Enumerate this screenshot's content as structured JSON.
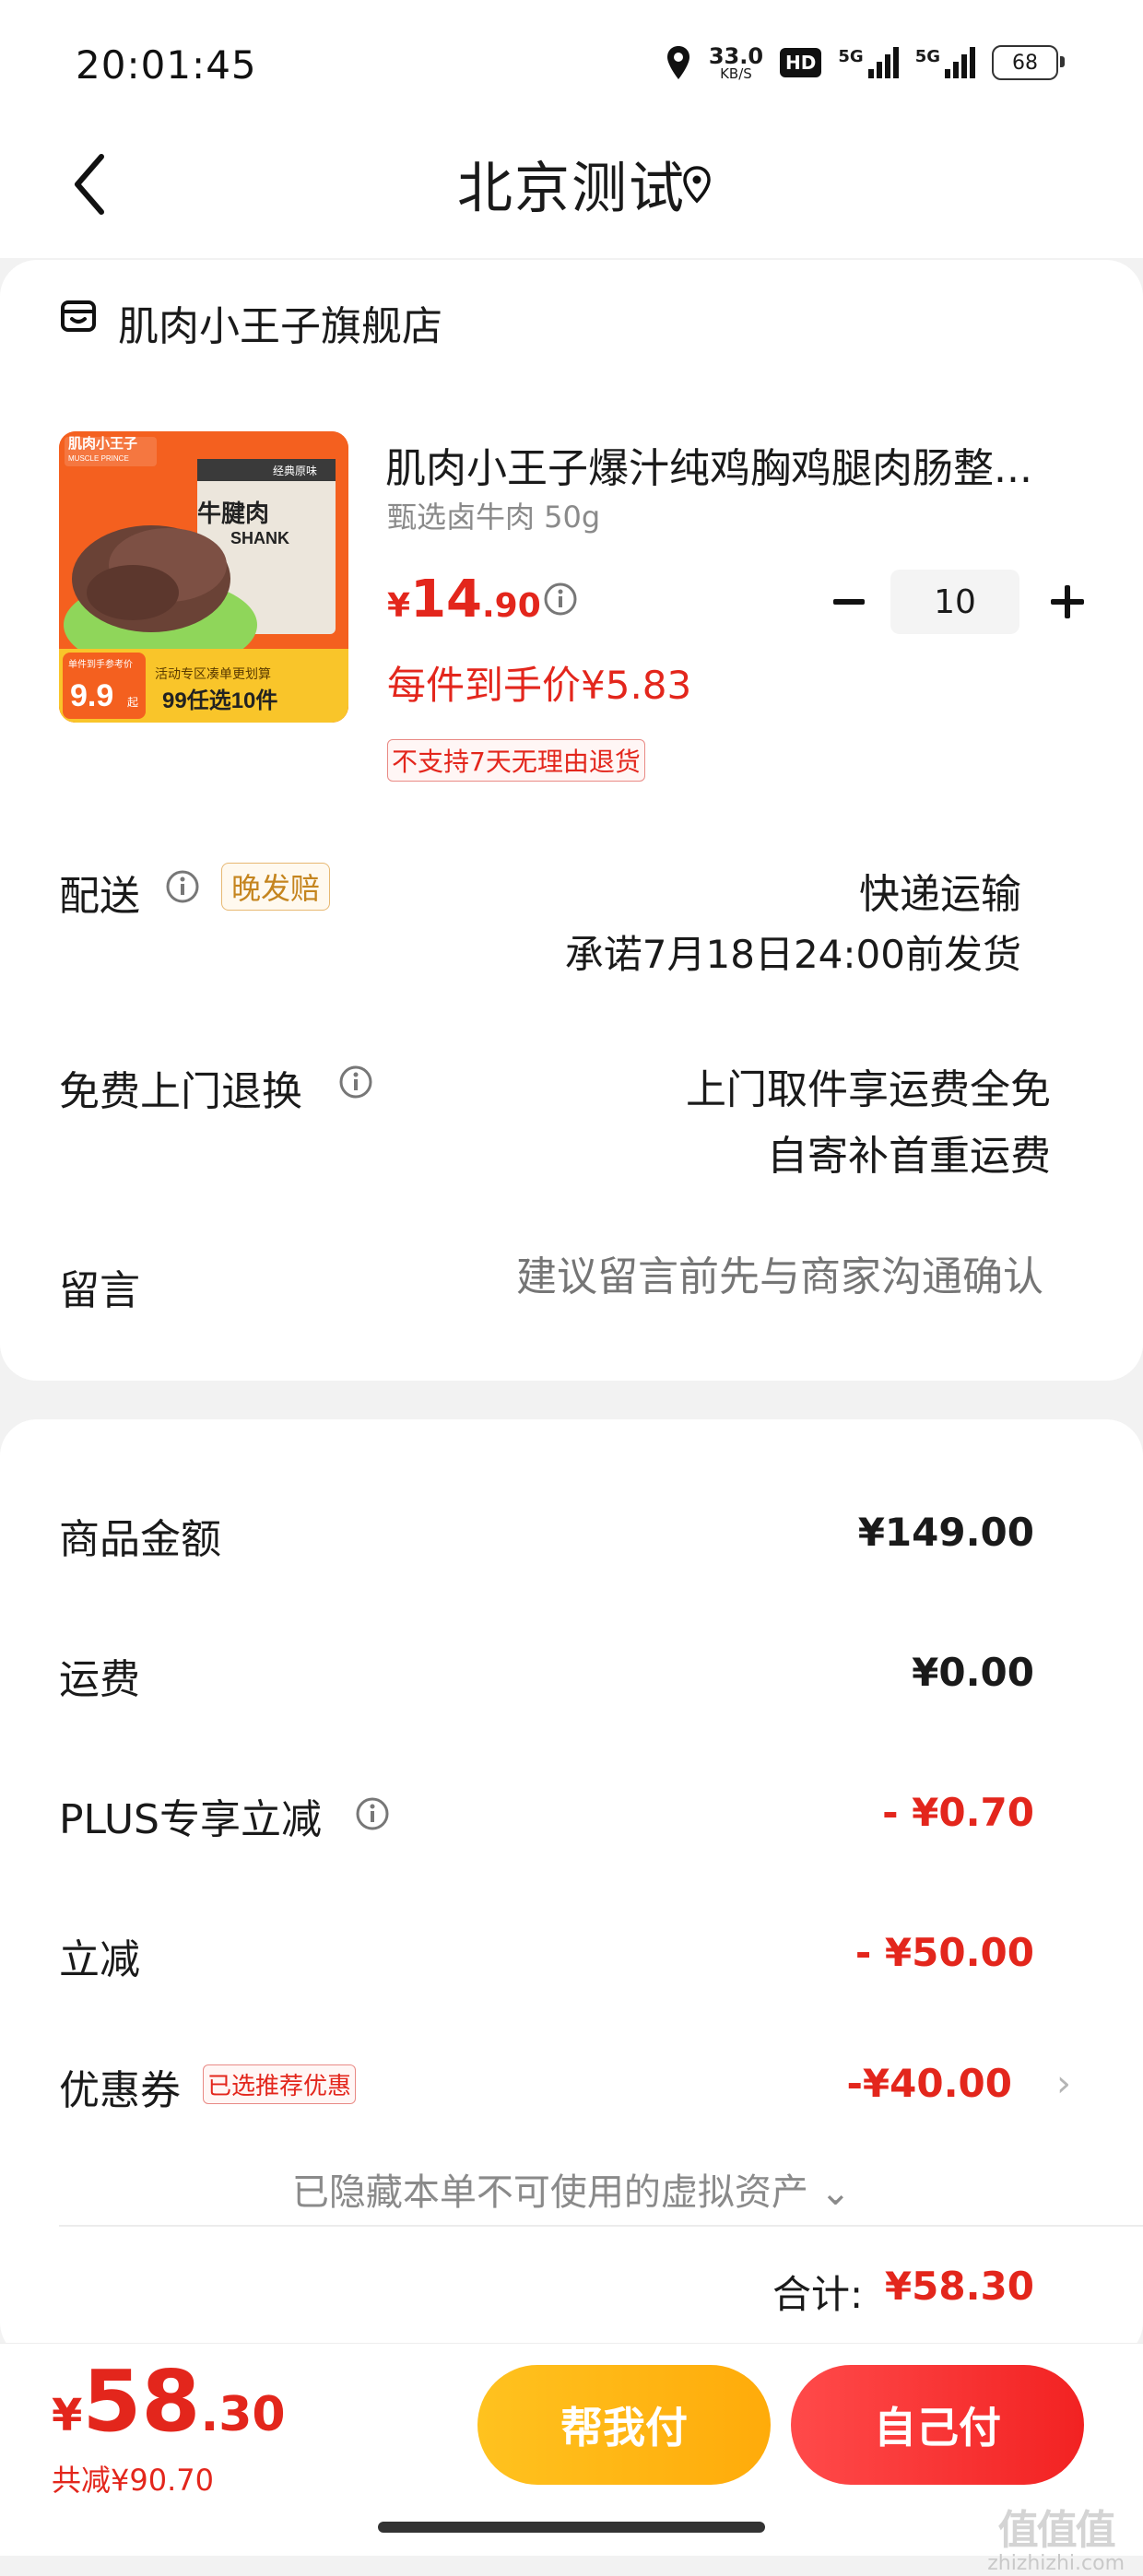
{
  "status_bar": {
    "time": "20:01:45",
    "net_speed": "33.0",
    "net_unit": "KB/S",
    "hd_label": "HD",
    "sig1_label": "5G",
    "sig2_label": "5G",
    "battery": "68"
  },
  "header": {
    "title": "北京测试"
  },
  "shop": {
    "name": "肌肉小王子旗舰店"
  },
  "product": {
    "name": "肌肉小王子爆汁纯鸡胸鸡腿肉肠整...",
    "spec": "甄选卤牛肉 50g",
    "price_currency": "¥",
    "price_int": "14",
    "price_dec": ".90",
    "unit_price": "每件到手价¥5.83",
    "return_policy": "不支持7天无理由退货",
    "image": {
      "brand": "肌肉小王子",
      "brand_en": "MUSCLE PRINCE",
      "pack_title": "牛腱肉",
      "pack_sub": "SHANK",
      "pack_tag": "经典原味",
      "price_badge": "9.9",
      "price_badge_top": "单件到手参考价",
      "price_badge_unit": "起",
      "promo_line1": "活动专区凑单更划算",
      "promo_line2": "99任选10件"
    }
  },
  "quantity": {
    "value": "10",
    "minus": "−",
    "plus": "+"
  },
  "delivery": {
    "label": "配送",
    "tag": "晚发赔",
    "method": "快递运输",
    "promise": "承诺7月18日24:00前发货"
  },
  "exchange": {
    "label": "免费上门退换",
    "line1": "上门取件享运费全免",
    "line2": "自寄补首重运费"
  },
  "message": {
    "label": "留言",
    "placeholder": "建议留言前先与商家沟通确认"
  },
  "summary": {
    "goods_label": "商品金额",
    "goods_value": "¥149.00",
    "shipping_label": "运费",
    "shipping_value": "¥0.00",
    "plus_label": "PLUS专享立减",
    "plus_value": "- ¥0.70",
    "discount_label": "立减",
    "discount_value": "- ¥50.00",
    "coupon_label": "优惠券",
    "coupon_tag": "已选推荐优惠",
    "coupon_value": "-¥40.00",
    "coupon_chevron": "›",
    "hidden_assets": "已隐藏本单不可使用的虚拟资产 ⌄",
    "total_label": "合计:",
    "total_value": "¥58.30"
  },
  "footer": {
    "currency": "¥",
    "amount_int": "58",
    "amount_dec": ".30",
    "saved": "共减¥90.70",
    "help_pay": "帮我付",
    "self_pay": "自己付"
  },
  "watermark": {
    "big": "值值值",
    "small": "zhizhizhi.com"
  },
  "colors": {
    "accent_red": "#e3261c",
    "help_pay_yellow": "#ffb514",
    "self_pay_red": "#f23030"
  }
}
